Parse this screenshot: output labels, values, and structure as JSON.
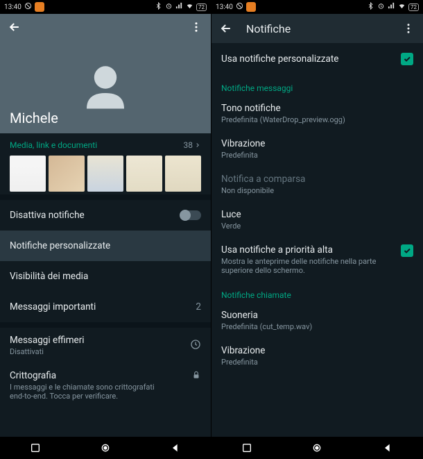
{
  "statusbar": {
    "time": "13:40",
    "battery": "72"
  },
  "screen1": {
    "contact_name": "Michele",
    "media_header": "Media, link e documenti",
    "media_count": "38",
    "rows": {
      "mute": "Disattiva notifiche",
      "custom_notifications": "Notifiche personalizzate",
      "media_visibility": "Visibilità dei media",
      "starred": "Messaggi importanti",
      "starred_count": "2",
      "ephemeral_title": "Messaggi effimeri",
      "ephemeral_sub": "Disattivati",
      "crypto_title": "Crittografia",
      "crypto_sub": "I messaggi e le chiamate sono crittografati end-to-end. Tocca per verificare."
    }
  },
  "screen2": {
    "title": "Notifiche",
    "use_custom": "Usa notifiche personalizzate",
    "section_messages": "Notifiche messaggi",
    "tone_title": "Tono notifiche",
    "tone_sub": "Predefinita (WaterDrop_preview.ogg)",
    "vibration_title": "Vibrazione",
    "vibration_sub": "Predefinita",
    "popup_title": "Notifica a comparsa",
    "popup_sub": "Non disponibile",
    "light_title": "Luce",
    "light_sub": "Verde",
    "high_priority_title": "Usa notifiche a priorità alta",
    "high_priority_sub": "Mostra le anteprime delle notifiche nella parte superiore dello schermo.",
    "section_calls": "Notifiche chiamate",
    "ringtone_title": "Suoneria",
    "ringtone_sub": "Predefinita (cut_temp.wav)",
    "call_vibration_title": "Vibrazione",
    "call_vibration_sub": "Predefinita"
  }
}
